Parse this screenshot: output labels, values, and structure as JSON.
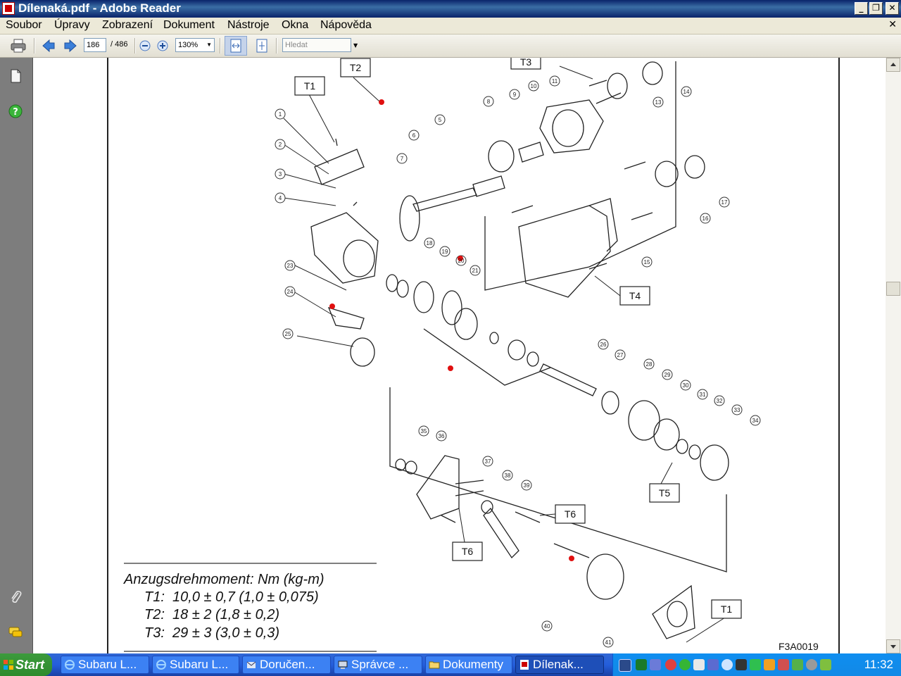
{
  "window": {
    "title": "Dílenaká.pdf - Adobe Reader"
  },
  "menu": [
    "Soubor",
    "Úpravy",
    "Zobrazení",
    "Dokument",
    "Nástroje",
    "Okna",
    "Nápověda"
  ],
  "toolbar": {
    "page_current": "186",
    "page_total": "/ 486",
    "zoom": "130%",
    "search_placeholder": "Hledat"
  },
  "diagram": {
    "callouts": [
      "T1",
      "T2",
      "T3",
      "T4",
      "T5",
      "T6",
      "T6",
      "T1"
    ],
    "torque_title": "Anzugsdrehmoment: Nm (kg-m)",
    "torque_rows": [
      "T1:  10,0 ± 0,7 (1,0 ± 0,075)",
      "T2:  18 ± 2 (1,8 ± 0,2)",
      "T3:  29 ± 3 (3,0 ± 0,3)"
    ],
    "figure_id": "F3A0019",
    "part_numbers": [
      "1",
      "2",
      "3",
      "4",
      "5",
      "6",
      "7",
      "8",
      "9",
      "10",
      "11",
      "13",
      "14",
      "15",
      "16",
      "17",
      "18",
      "19",
      "20",
      "21",
      "23",
      "24",
      "25",
      "26",
      "27",
      "28",
      "29",
      "30",
      "31",
      "32",
      "33",
      "34",
      "35",
      "36",
      "37",
      "38",
      "39",
      "40",
      "41"
    ]
  },
  "taskbar": {
    "start_label": "Start",
    "tasks": [
      "Subaru L...",
      "Subaru L...",
      "Doručen...",
      "Správce ...",
      "Dokumenty",
      "Dílenak..."
    ],
    "clock": "11:32"
  }
}
